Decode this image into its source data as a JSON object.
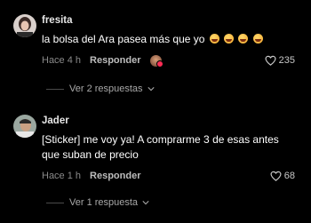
{
  "comments": [
    {
      "username": "fresita",
      "text": "la bolsa del Ara pasea más que yo",
      "emoji_icons": [
        "laughing-face-emoji",
        "laughing-face-emoji",
        "laughing-face-emoji",
        "laughing-face-emoji"
      ],
      "time": "Hace 4 h",
      "reply_label": "Responder",
      "likes": "235",
      "view_replies": "Ver 2 respuestas"
    },
    {
      "username": "Jader",
      "text": "[Sticker] me voy ya! A comprarme 3 de esas antes que suban de precio",
      "time": "Hace 1 h",
      "reply_label": "Responder",
      "likes": "68",
      "view_replies": "Ver 1 respuesta"
    }
  ],
  "colors": {
    "background": "#000000",
    "text": "#ffffff",
    "muted": "#8a8a8a",
    "accent": "#fe2c55"
  }
}
